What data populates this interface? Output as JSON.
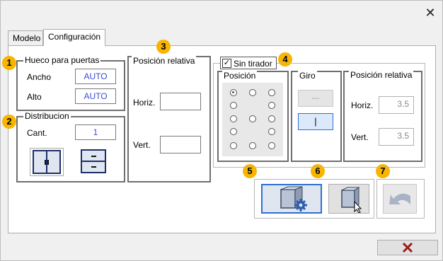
{
  "window": {
    "close_icon": "✕"
  },
  "tabs": [
    {
      "label": "Modelo",
      "active": false
    },
    {
      "label": "Configuración",
      "active": true
    }
  ],
  "badges": [
    "1",
    "2",
    "3",
    "4",
    "5",
    "6",
    "7"
  ],
  "hueco": {
    "title": "Hueco para puertas",
    "ancho_label": "Ancho",
    "ancho_value": "AUTO",
    "alto_label": "Alto",
    "alto_value": "AUTO"
  },
  "distribucion": {
    "title": "Distribucion",
    "cant_label": "Cant.",
    "cant_value": "1"
  },
  "posicion_relativa": {
    "title": "Posición relativa",
    "horiz_label": "Horiz.",
    "horiz_value": "",
    "vert_label": "Vert.",
    "vert_value": ""
  },
  "sin_tirador": {
    "label": "Sin tirador",
    "checked": true,
    "check_glyph": "✓"
  },
  "posicion": {
    "title": "Posición",
    "selected_index": 0
  },
  "giro": {
    "title": "Giro",
    "btn1_label": "---",
    "btn2_label": "|"
  },
  "posicion_relativa2": {
    "title": "Posición relativa",
    "horiz_label": "Horiz.",
    "horiz_value": "3.5",
    "vert_label": "Vert.",
    "vert_value": "3.5"
  },
  "colors": {
    "accent": "#3b4bd6",
    "badge": "#f7b500",
    "cancel": "#a11a1a"
  }
}
